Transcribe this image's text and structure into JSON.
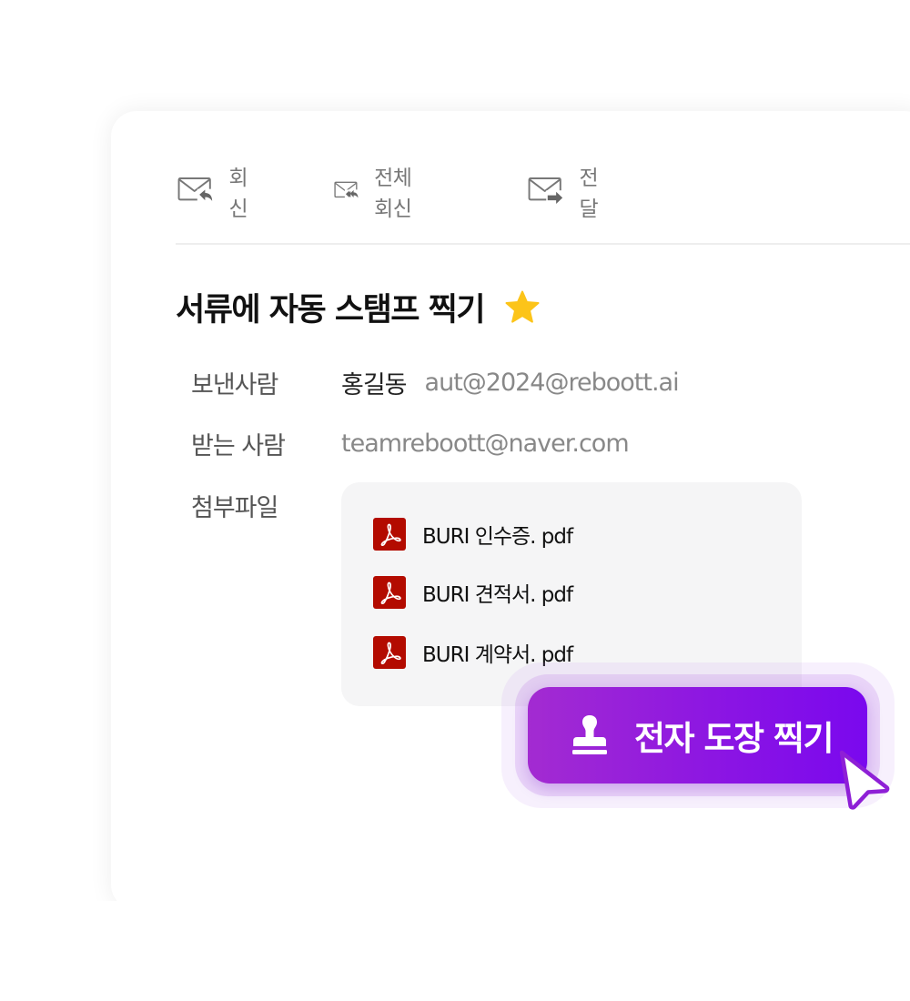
{
  "toolbar": {
    "reply": {
      "label": "회신",
      "icon": "mail-reply-icon"
    },
    "reply_all": {
      "label": "전체회신",
      "icon": "mail-reply-all-icon"
    },
    "forward": {
      "label": "전달",
      "icon": "mail-forward-icon"
    }
  },
  "mail": {
    "subject": "서류에 자동 스탬프 찍기",
    "starred": true,
    "sender_label": "보낸사람",
    "sender_name": "홍길동",
    "sender_email": "aut@2024@reboott.ai",
    "recipient_label": "받는 사람",
    "recipient_email": "teamreboott@naver.com",
    "attachments_label": "첨부파일",
    "attachments": [
      {
        "name": "BURI 인수증. pdf",
        "icon": "pdf-icon"
      },
      {
        "name": "BURI 견적서. pdf",
        "icon": "pdf-icon"
      },
      {
        "name": "BURI 계약서. pdf",
        "icon": "pdf-icon"
      }
    ]
  },
  "action": {
    "stamp_label": "전자 도장 찍기",
    "icon": "stamp-icon"
  },
  "colors": {
    "accent_start": "#a32bd1",
    "accent_end": "#7a08ee",
    "star": "#fcc419",
    "pdf": "#b30b00"
  }
}
